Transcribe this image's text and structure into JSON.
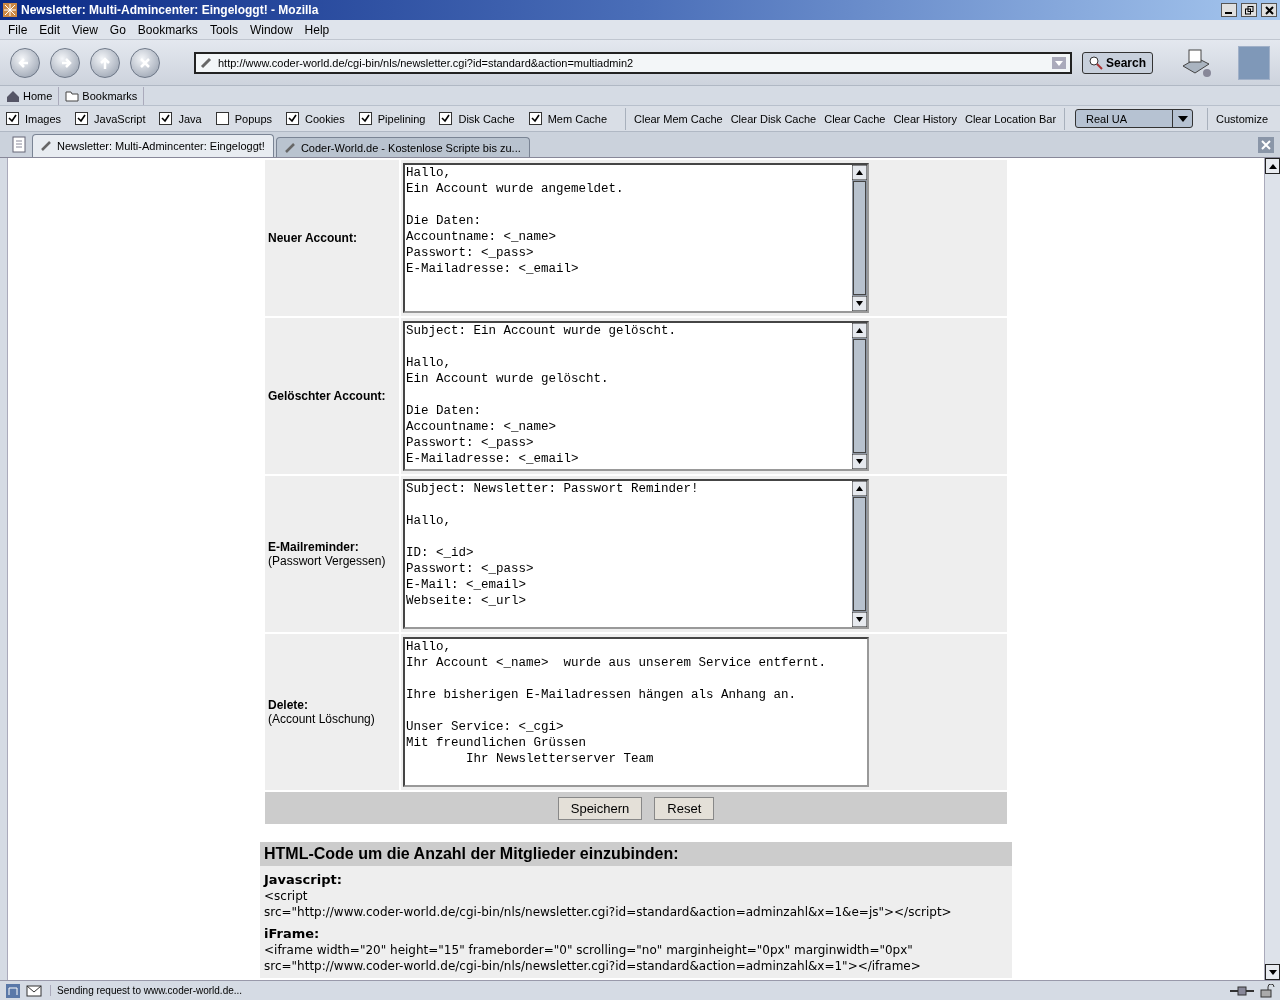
{
  "window": {
    "title": "Newsletter: Multi-Admincenter: Eingeloggt! - Mozilla"
  },
  "menu": [
    "File",
    "Edit",
    "View",
    "Go",
    "Bookmarks",
    "Tools",
    "Window",
    "Help"
  ],
  "navigation": {
    "url": "http://www.coder-world.de/cgi-bin/nls/newsletter.cgi?id=standard&action=multiadmin2",
    "search_button": "Search"
  },
  "personal_bar": [
    "Home",
    "Bookmarks"
  ],
  "pref_bar": {
    "checkboxes": [
      {
        "label": "Images",
        "checked": true
      },
      {
        "label": "JavaScript",
        "checked": true
      },
      {
        "label": "Java",
        "checked": true
      },
      {
        "label": "Popups",
        "checked": false
      },
      {
        "label": "Cookies",
        "checked": true
      },
      {
        "label": "Pipelining",
        "checked": true
      },
      {
        "label": "Disk Cache",
        "checked": true
      },
      {
        "label": "Mem Cache",
        "checked": true
      }
    ],
    "buttons": [
      "Clear Mem Cache",
      "Clear Disk Cache",
      "Clear Cache",
      "Clear History",
      "Clear Location Bar"
    ],
    "dropdown": "Real UA",
    "customize": "Customize"
  },
  "tabs": [
    {
      "label": "Newsletter: Multi-Admincenter: Eingeloggt!",
      "selected": true
    },
    {
      "label": "Coder-World.de - Kostenlose Scripte bis zu...",
      "selected": false
    }
  ],
  "form": {
    "rows": [
      {
        "label": "Neuer Account:",
        "has_scrollbar": true,
        "value": "Hallo,\nEin Account wurde angemeldet.\n\nDie Daten:\nAccountname: <_name>\nPasswort: <_pass>\nE-Mailadresse: <_email>"
      },
      {
        "label": "Gelöschter Account:",
        "has_scrollbar": true,
        "value": "Subject: Ein Account wurde gelöscht.\n\nHallo,\nEin Account wurde gelöscht.\n\nDie Daten:\nAccountname: <_name>\nPasswort: <_pass>\nE-Mailadresse: <_email>"
      },
      {
        "label": "E-Mailreminder:",
        "sublabel": "(Passwort Vergessen)",
        "has_scrollbar": true,
        "value": "Subject: Newsletter: Passwort Reminder!\n\nHallo,\n\nID: <_id>\nPasswort: <_pass>\nE-Mail: <_email>\nWebseite: <_url>"
      },
      {
        "label": "Delete:",
        "sublabel": "(Account Löschung)",
        "has_scrollbar": false,
        "value": "Hallo,\nIhr Account <_name>  wurde aus unserem Service entfernt.\n\nIhre bisherigen E-Mailadressen hängen als Anhang an.\n\nUnser Service: <_cgi>\nMit freundlichen Grüssen\n        Ihr Newsletterserver Team"
      }
    ],
    "buttons": [
      "Speichern",
      "Reset"
    ]
  },
  "html_code": {
    "heading": "HTML-Code um die Anzahl der Mitglieder einzubinden:",
    "blocks": [
      {
        "title": "Javascript:",
        "lines": [
          "<script",
          "src=\"http://www.coder-world.de/cgi-bin/nls/newsletter.cgi?id=standard&action=adminzahl&x=1&e=js\"></script>"
        ]
      },
      {
        "title": "iFrame:",
        "lines": [
          "<iframe width=\"20\" height=\"15\" frameborder=\"0\" scrolling=\"no\" marginheight=\"0px\" marginwidth=\"0px\"",
          "src=\"http://www.coder-world.de/cgi-bin/nls/newsletter.cgi?id=standard&action=adminzahl&x=1\"></iframe>"
        ]
      }
    ]
  },
  "status_bar": {
    "text": "Sending request to www.coder-world.de..."
  }
}
